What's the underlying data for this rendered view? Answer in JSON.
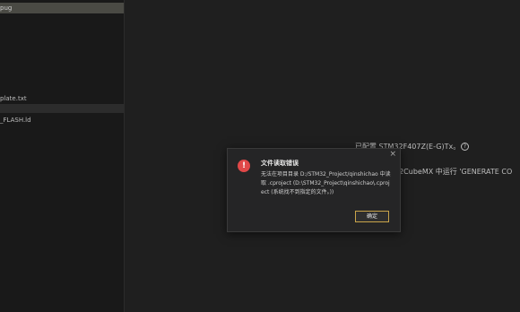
{
  "sidebar": {
    "top_item": "pug",
    "item_plate": "plate.txt",
    "item_flash": "_FLASH.ld"
  },
  "background": {
    "line1": "已配置 STM32F407Z(E-G)Tx。",
    "line2": "32CubeMX 中运行 'GENERATE CO"
  },
  "dialog": {
    "title": "文件读取错误",
    "message": "无法在项目目录 D:/STM32_Project/qinshichao 中读取 .cproject (D:\\STM32_Project\\qinshichao\\.cproject (系统找不到指定的文件。))",
    "ok_label": "确定",
    "close_glyph": "×",
    "error_glyph": "!"
  },
  "colors": {
    "error_icon": "#e04848",
    "ok_border": "#c9a44a"
  }
}
